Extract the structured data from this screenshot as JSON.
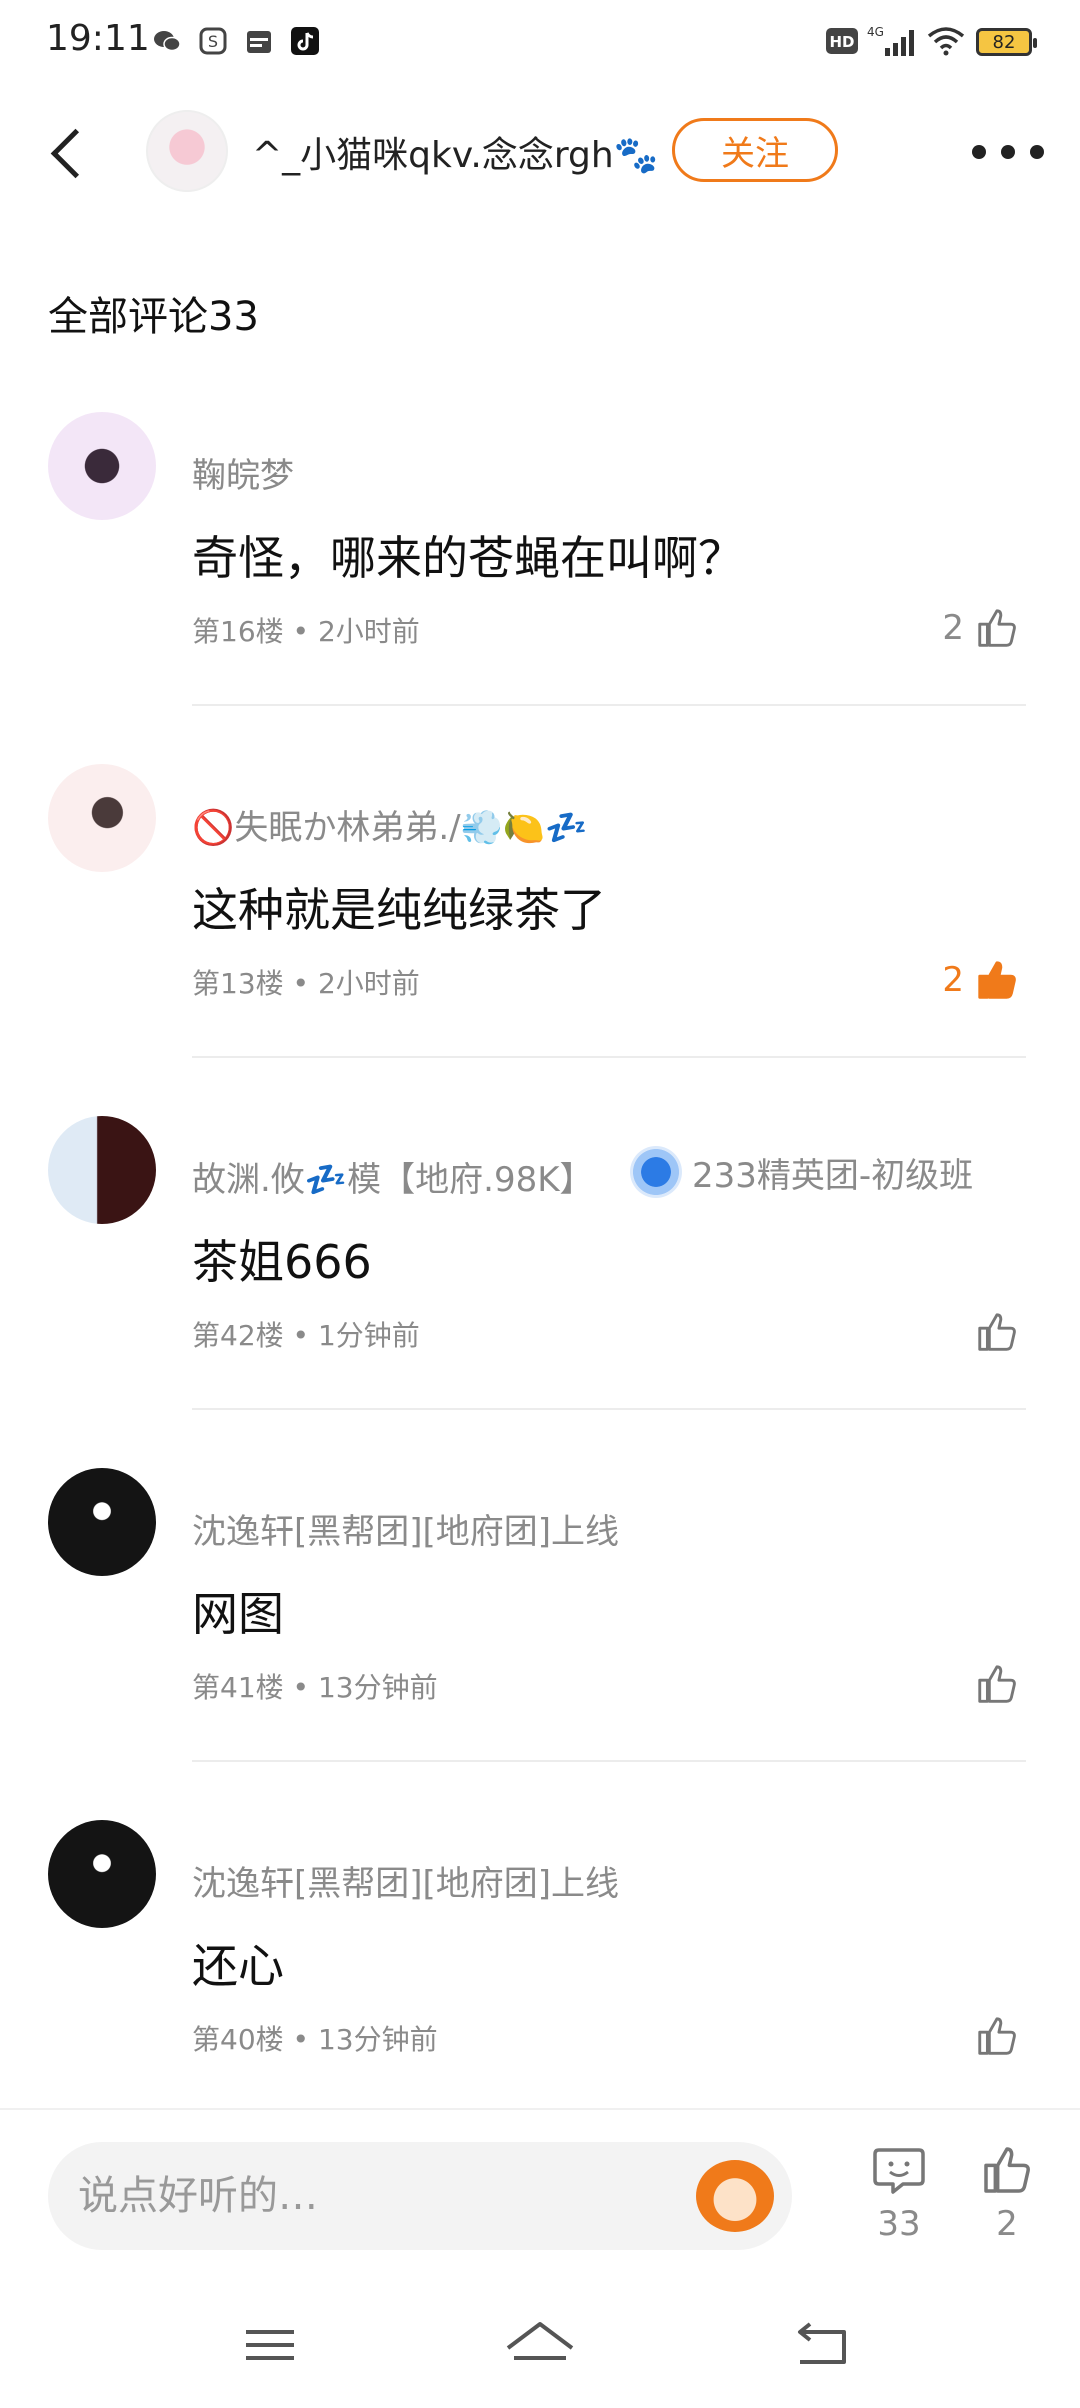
{
  "status_bar": {
    "time": "19:11",
    "battery": "82",
    "network": "4G",
    "hd": "HD"
  },
  "header": {
    "username": "^_小猫咪qkv.念念rgh🐾",
    "follow_label": "关注"
  },
  "section_title": "全部评论33",
  "comments": [
    {
      "name": "鞠皖梦",
      "text": "奇怪，哪来的苍蝇在叫啊？",
      "meta": "第16楼 • 2小时前",
      "likes": "2",
      "liked": false
    },
    {
      "name": "🚫失眠か林弟弟./💨🍋💤",
      "text": "这种就是纯纯绿茶了",
      "meta": "第13楼 • 2小时前",
      "likes": "2",
      "liked": true
    },
    {
      "name": "故渊.攸💤模【地府.98K】",
      "badge": "233精英团-初级班",
      "text": "茶姐666",
      "meta": "第42楼 • 1分钟前",
      "likes": "",
      "liked": false
    },
    {
      "name": "沈逸轩[黑帮团][地府团]上线",
      "text": "网图",
      "meta": "第41楼 • 13分钟前",
      "likes": "",
      "liked": false
    },
    {
      "name": "沈逸轩[黑帮团][地府团]上线",
      "text": "还心",
      "meta": "第40楼 • 13分钟前",
      "likes": "",
      "liked": false
    }
  ],
  "bottom_bar": {
    "input_placeholder": "说点好听的…",
    "comment_count": "33",
    "like_count": "2"
  },
  "colors": {
    "accent": "#f07a1a",
    "meta_text": "#8a8a8a",
    "divider": "#ececec"
  }
}
